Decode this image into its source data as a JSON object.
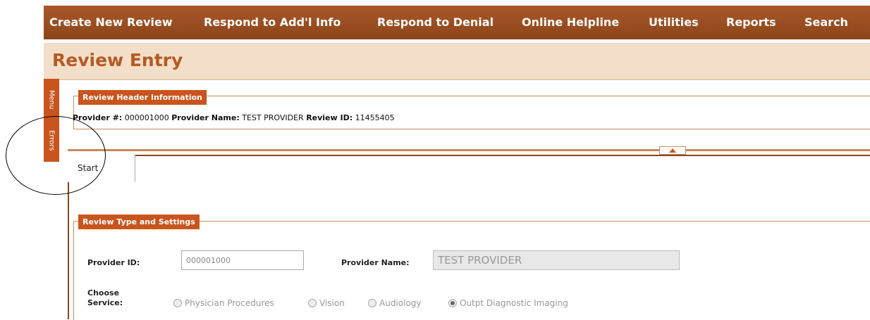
{
  "nav": {
    "items": [
      {
        "label": "Create New Review"
      },
      {
        "label": "Respond to Add'l Info"
      },
      {
        "label": "Respond to Denial"
      },
      {
        "label": "Online Helpline"
      },
      {
        "label": "Utilities"
      },
      {
        "label": "Reports"
      },
      {
        "label": "Search"
      }
    ]
  },
  "page": {
    "title": "Review Entry"
  },
  "side_tabs": {
    "menu": "Menu",
    "errors": "Errors"
  },
  "header_info": {
    "legend": "Review Header Information",
    "provider_num_label": "Provider #:",
    "provider_num_value": "000001000",
    "provider_name_label": "Provider Name:",
    "provider_name_value": "TEST PROVIDER",
    "review_id_label": "Review ID:",
    "review_id_value": "11455405"
  },
  "tabs": {
    "start": "Start"
  },
  "review_settings": {
    "legend": "Review Type and Settings",
    "provider_id_label": "Provider ID:",
    "provider_id_value": "000001000",
    "provider_name_label": "Provider Name:",
    "provider_name_value": "TEST PROVIDER",
    "choose_service_label_1": "Choose",
    "choose_service_label_2": "Service:",
    "services": [
      {
        "label": "Physician Procedures",
        "selected": false
      },
      {
        "label": "Vision",
        "selected": false
      },
      {
        "label": "Audiology",
        "selected": false
      },
      {
        "label": "Outpt Diagnostic Imaging",
        "selected": true
      }
    ]
  },
  "colors": {
    "nav_bg": "#8c4519",
    "accent": "#c9541d",
    "banner_bg": "#f3dfc9",
    "title": "#b55a22"
  }
}
